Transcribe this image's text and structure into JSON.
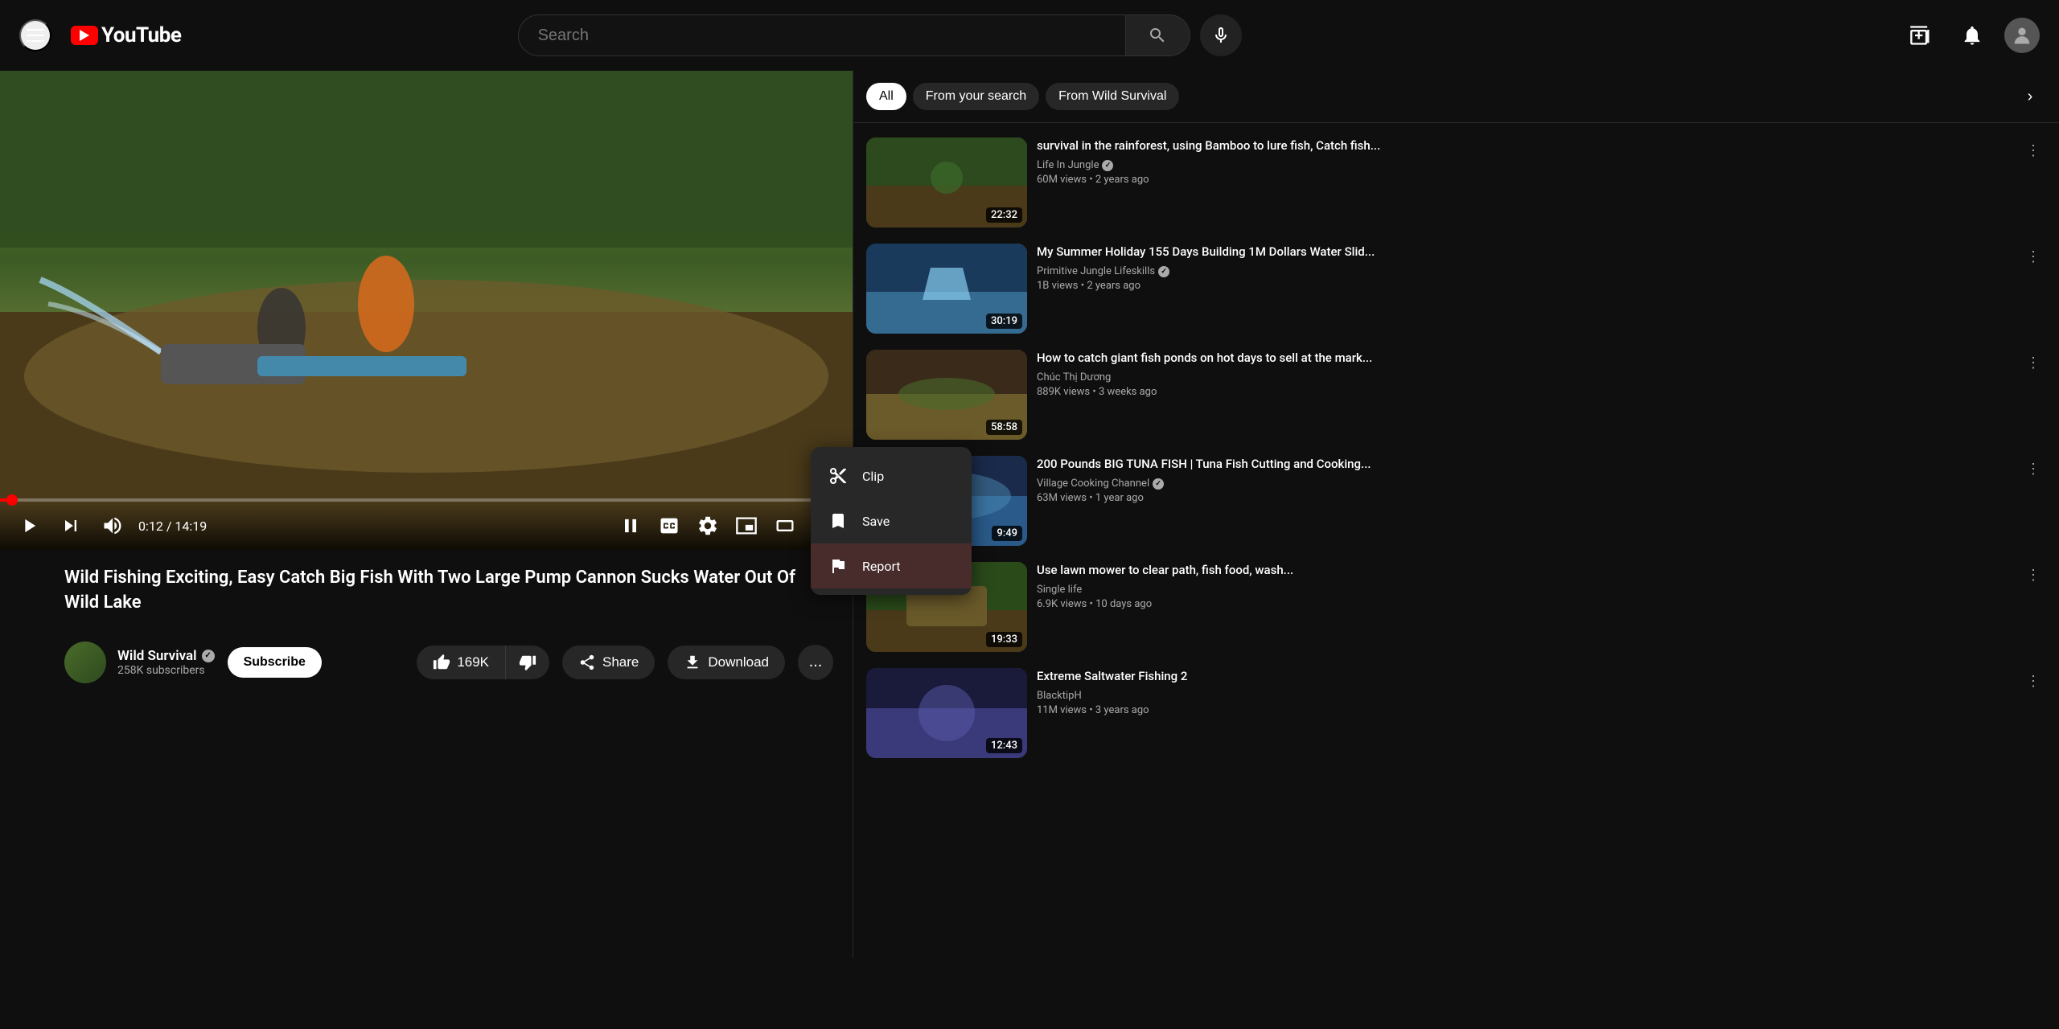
{
  "header": {
    "menu_label": "Menu",
    "logo_text": "YouTube",
    "search_placeholder": "Search",
    "mic_label": "Search with voice"
  },
  "video": {
    "title": "Wild Fishing Exciting, Easy Catch Big Fish With Two Large Pump Cannon Sucks Water Out Of Wild Lake",
    "time_current": "0:12",
    "time_total": "14:19",
    "progress_pct": 1.4,
    "channel_name": "Wild Survival",
    "channel_subscribers": "258K subscribers",
    "like_count": "169K",
    "controls": {
      "play": "▶",
      "next": "⏭",
      "volume": "🔊",
      "pause_icon": "⏸",
      "cc": "CC",
      "settings": "⚙",
      "miniplayer": "⊡",
      "theater": "⬜",
      "fullscreen": "⛶"
    },
    "action_buttons": {
      "share": "Share",
      "download": "Download",
      "subscribe": "Subscribe",
      "more": "..."
    }
  },
  "context_menu": {
    "items": [
      {
        "id": "clip",
        "label": "Clip",
        "icon": "✂"
      },
      {
        "id": "save",
        "label": "Save",
        "icon": "🔖"
      },
      {
        "id": "report",
        "label": "Report",
        "icon": "🚩"
      }
    ]
  },
  "sidebar": {
    "tabs": [
      {
        "id": "all",
        "label": "All",
        "active": true
      },
      {
        "id": "from-search",
        "label": "From your search",
        "active": false
      },
      {
        "id": "from-channel",
        "label": "From Wild Survival",
        "active": false
      }
    ],
    "videos": [
      {
        "title": "survival in the rainforest, using Bamboo to lure fish, Catch fish...",
        "channel": "Life In Jungle",
        "verified": true,
        "views": "60M views",
        "age": "2 years ago",
        "duration": "22:32",
        "thumb_class": "thumb-1"
      },
      {
        "title": "My Summer Holiday 155 Days Building 1M Dollars Water Slid...",
        "channel": "Primitive Jungle Lifeskills",
        "verified": true,
        "views": "1B views",
        "age": "2 years ago",
        "duration": "30:19",
        "thumb_class": "thumb-2"
      },
      {
        "title": "How to catch giant fish ponds on hot days to sell at the mark...",
        "channel": "Chúc Thị Dương",
        "verified": false,
        "views": "889K views",
        "age": "3 weeks ago",
        "duration": "58:58",
        "thumb_class": "thumb-3"
      },
      {
        "title": "200 Pounds BIG TUNA FISH | Tuna Fish Cutting and Cooking...",
        "channel": "Village Cooking Channel",
        "verified": true,
        "views": "63M views",
        "age": "1 year ago",
        "duration": "9:49",
        "thumb_class": "thumb-4"
      },
      {
        "title": "Use lawn mower to clear path, fish food, wash...",
        "channel": "Single life",
        "verified": false,
        "views": "6.9K views",
        "age": "10 days ago",
        "duration": "19:33",
        "thumb_class": "thumb-5"
      },
      {
        "title": "Extreme Saltwater Fishing 2",
        "channel": "BlacktipH",
        "verified": false,
        "views": "11M views",
        "age": "3 years ago",
        "duration": "12:43",
        "thumb_class": "thumb-6"
      }
    ]
  }
}
